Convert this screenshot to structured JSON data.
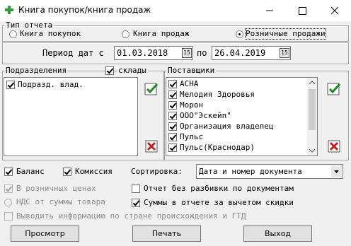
{
  "window": {
    "title": "Книга покупок/книга продаж",
    "minimize": "—",
    "maximize": "☐",
    "close": "✕"
  },
  "report_type": {
    "label": "Тип отчета",
    "options": [
      {
        "label": "Книга покупок",
        "selected": false
      },
      {
        "label": "Книга продаж",
        "selected": false
      },
      {
        "label": "Розничные продажи",
        "selected": true
      }
    ]
  },
  "period": {
    "label": "Период дат с",
    "from": "01.03.2018",
    "to_label": "по",
    "to": "26.04.2019",
    "cal_label": "15"
  },
  "departments": {
    "label": "Подразделения",
    "warehouses_label": "склады",
    "warehouses_checked": true,
    "items": [
      {
        "label": "Подразд. влад.",
        "checked": true
      }
    ]
  },
  "suppliers": {
    "label": "Поставщики",
    "items": [
      {
        "label": "АСНА",
        "checked": true
      },
      {
        "label": "Мелодия Здоровья",
        "checked": true
      },
      {
        "label": "Морон",
        "checked": true
      },
      {
        "label": "ООО\"Эскейп\"",
        "checked": true
      },
      {
        "label": "Организация владелец",
        "checked": true
      },
      {
        "label": "Пульс",
        "checked": true
      },
      {
        "label": "Пульс(Краснодар)",
        "checked": true
      }
    ]
  },
  "options": {
    "balance": "Баланс",
    "commission": "Комиссия",
    "sort_label": "Сортировка:",
    "sort_value": "Дата и номер документа",
    "retail_prices": "В розничных ценах",
    "no_breakdown": "Отчет без разбивки по документам",
    "vat_from_sum": "НДС от суммы товара",
    "net_of_discount": "Суммы в отчете за вычетом скидки",
    "country_info": "Выводить информацию по стране происхождения и ГТД"
  },
  "buttons": {
    "preview": "Просмотр",
    "print": "Печать",
    "exit": "Выход"
  },
  "colors": {
    "app_icon": "#2e9e3c",
    "apply_icon": "#1e8a1e",
    "clear_icon": "#c02020"
  }
}
